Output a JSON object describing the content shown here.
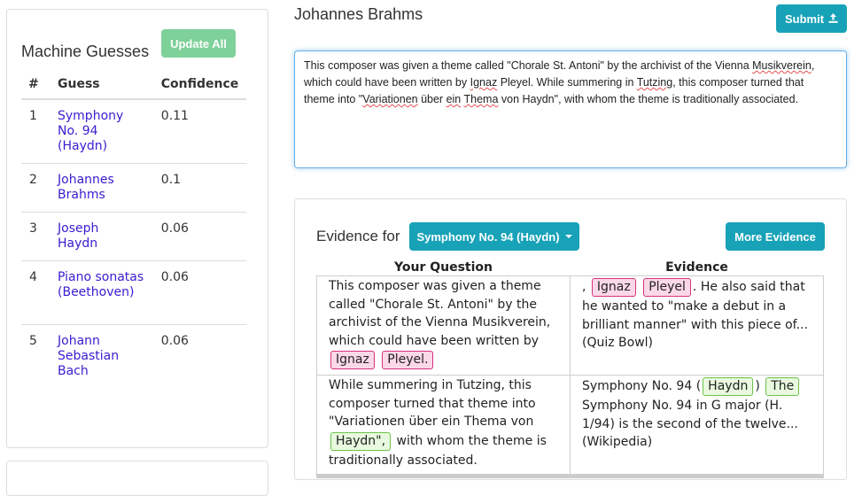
{
  "machine_guesses": {
    "title": "Machine Guesses",
    "update_button": "Update All",
    "headers": {
      "num": "#",
      "guess": "Guess",
      "confidence": "Confidence"
    },
    "rows": [
      {
        "num": "1",
        "guess": "Symphony No. 94 (Haydn)",
        "confidence": "0.11"
      },
      {
        "num": "2",
        "guess": "Johannes Brahms",
        "confidence": "0.1"
      },
      {
        "num": "3",
        "guess": "Joseph Haydn",
        "confidence": "0.06"
      },
      {
        "num": "4",
        "guess": "Piano sonatas (Beethoven)",
        "confidence": "0.06"
      },
      {
        "num": "5",
        "guess": "Johann Sebastian Bach",
        "confidence": "0.06"
      }
    ]
  },
  "answer": {
    "title": "Johannes Brahms",
    "submit_button": "Submit"
  },
  "question": {
    "part1": "This composer was given a theme called \"Chorale St. Antoni\" by the archivist of the Vienna ",
    "w_musik": "Musikverein",
    "part2": ", which could have been written by ",
    "w_ignaz": "Ignaz",
    "part3": " Pleyel.  While summering in ",
    "w_tutzing": "Tutzing",
    "part4": ", this composer turned that theme into \"",
    "w_variationen": "Variationen",
    "part5": " über ",
    "w_ein": "ein",
    "part6": " ",
    "w_thema": "Thema",
    "part7": " von Haydn\", with whom the theme is traditionally associated."
  },
  "evidence": {
    "label": "Evidence for",
    "dropdown_selected": "Symphony No. 94 (Haydn)",
    "more_button": "More Evidence",
    "col_question": "Your Question",
    "col_evidence": "Evidence",
    "rows": [
      {
        "q_text": "This composer was given a theme called \"Chorale St. Antoni\" by the archivist of the Vienna Musikverein, which could have been written by",
        "q_hl1": "Ignaz",
        "q_hl2": "Pleyel.",
        "e_pre": ",",
        "e_hl1": "Ignaz",
        "e_hl2": "Pleyel",
        "e_text": ". He also said that he wanted to \"make a debut in a brilliant manner\" with this piece of... (Quiz Bowl)"
      },
      {
        "q_text": "While summering in Tutzing, this composer turned that theme into \"Variationen über ein Thema von",
        "q_hl1": "Haydn\",",
        "q_post": "with whom the theme is traditionally associated.",
        "e_pre": "Symphony No. 94 (",
        "e_hl1": "Haydn",
        "e_mid": ")",
        "e_hl2": "The",
        "e_text": "Symphony No. 94 in G major (H. 1/94) is the second of the twelve... (Wikipedia)"
      }
    ]
  },
  "colors": {
    "accent": "#17a2b8",
    "update_button": "#7fd19a",
    "link": "#3b1bd1",
    "highlight_pink": "#d6337a",
    "highlight_green": "#6cc24a"
  }
}
